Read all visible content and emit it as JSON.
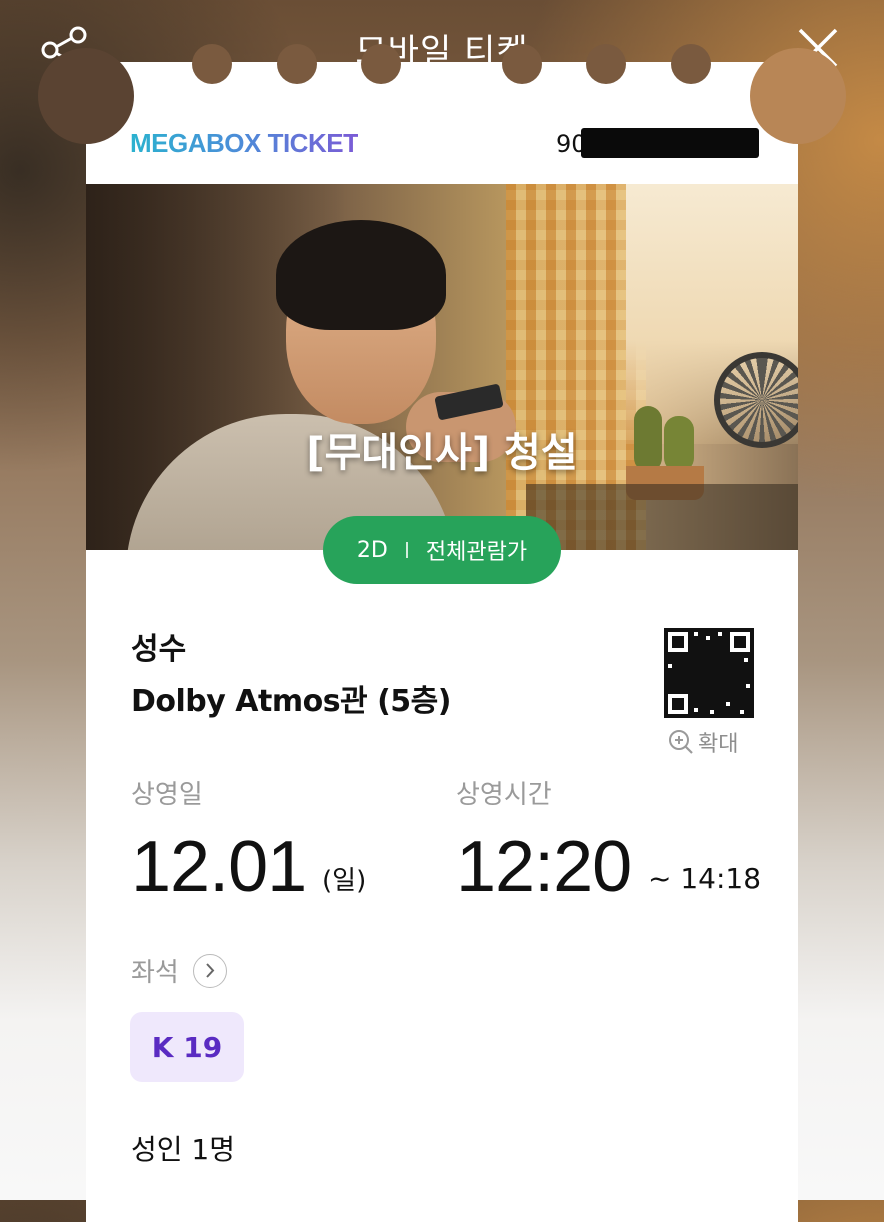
{
  "header": {
    "title": "모바일 티켓",
    "share_icon": "share-icon",
    "close_icon": "close-icon"
  },
  "ticket": {
    "brand": "MEGABOX TICKET",
    "booking_number_visible": "90",
    "movie_title": "[무대인사] 청설",
    "format": "2D",
    "rating": "전체관람가",
    "cinema": "성수",
    "screen": "Dolby Atmos관 (5층)",
    "qr_zoom_label": "확대",
    "date_label": "상영일",
    "date": "12.01",
    "day": "(일)",
    "time_label": "상영시간",
    "start_time": "12:20",
    "end_time": "~ 14:18",
    "seat_label": "좌석",
    "seat": "K 19",
    "audience": "성인 1명"
  },
  "colors": {
    "brand_gradient_start": "#2bb2cf",
    "brand_gradient_end": "#7b5bd6",
    "pill_green": "#27a35a",
    "seat_chip_bg": "#efe8fc",
    "seat_chip_text": "#5a2bc2"
  }
}
